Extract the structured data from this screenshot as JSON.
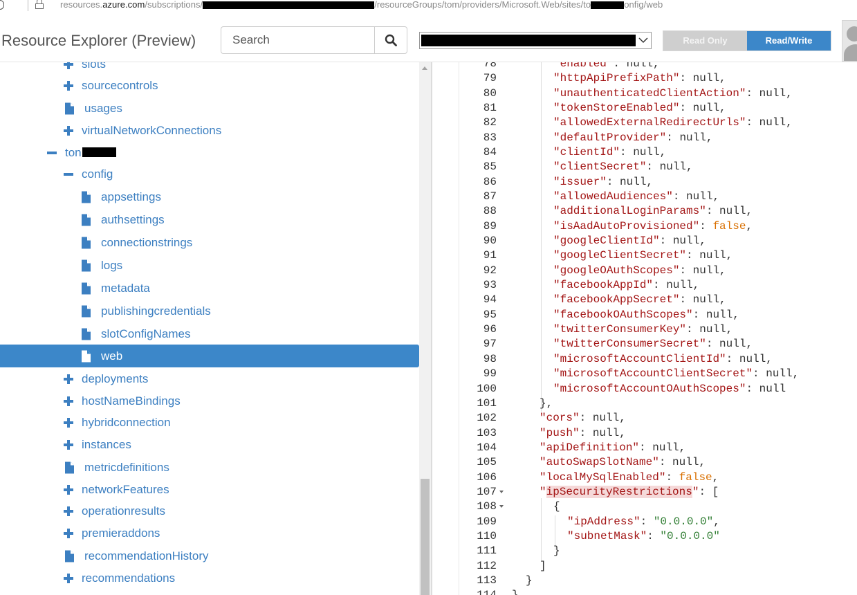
{
  "browser": {
    "url_prefix": "resources.",
    "url_domain": "azure.com",
    "url_part1": "/subscriptions/",
    "url_part2": "/resourceGroups/tom/providers/Microsoft.Web/sites/to",
    "url_part3": "onfig/web"
  },
  "header": {
    "title": "Resource Explorer (Preview)",
    "search_placeholder": "Search",
    "read_only_label": "Read Only",
    "read_write_label": "Read/Write",
    "accent_color": "#3c87c9"
  },
  "tree": {
    "items": [
      {
        "label": "slots",
        "icon": "plus-icon"
      },
      {
        "label": "sourcecontrols",
        "icon": "plus-icon"
      },
      {
        "label": "usages",
        "icon": "file-icon"
      },
      {
        "label": "virtualNetworkConnections",
        "icon": "plus-icon"
      },
      {
        "label": "ton",
        "icon": "minus-icon"
      },
      {
        "label": "config",
        "icon": "minus-icon"
      },
      {
        "label": "appsettings",
        "icon": "file-icon"
      },
      {
        "label": "authsettings",
        "icon": "file-icon"
      },
      {
        "label": "connectionstrings",
        "icon": "file-icon"
      },
      {
        "label": "logs",
        "icon": "file-icon"
      },
      {
        "label": "metadata",
        "icon": "file-icon"
      },
      {
        "label": "publishingcredentials",
        "icon": "file-icon"
      },
      {
        "label": "slotConfigNames",
        "icon": "file-icon"
      },
      {
        "label": "web",
        "icon": "file-icon",
        "selected": true
      },
      {
        "label": "deployments",
        "icon": "plus-icon"
      },
      {
        "label": "hostNameBindings",
        "icon": "plus-icon"
      },
      {
        "label": "hybridconnection",
        "icon": "plus-icon"
      },
      {
        "label": "instances",
        "icon": "plus-icon"
      },
      {
        "label": "metricdefinitions",
        "icon": "file-icon"
      },
      {
        "label": "networkFeatures",
        "icon": "plus-icon"
      },
      {
        "label": "operationresults",
        "icon": "plus-icon"
      },
      {
        "label": "premieraddons",
        "icon": "plus-icon"
      },
      {
        "label": "recommendationHistory",
        "icon": "file-icon"
      },
      {
        "label": "recommendations",
        "icon": "plus-icon"
      }
    ]
  },
  "editor": {
    "lines": [
      {
        "n": "78",
        "key": "enabled",
        "val": "null",
        "type": "null",
        "comma": true
      },
      {
        "n": "79",
        "key": "httpApiPrefixPath",
        "val": "null",
        "type": "null",
        "comma": true
      },
      {
        "n": "80",
        "key": "unauthenticatedClientAction",
        "val": "null",
        "type": "null",
        "comma": true
      },
      {
        "n": "81",
        "key": "tokenStoreEnabled",
        "val": "null",
        "type": "null",
        "comma": true
      },
      {
        "n": "82",
        "key": "allowedExternalRedirectUrls",
        "val": "null",
        "type": "null",
        "comma": true
      },
      {
        "n": "83",
        "key": "defaultProvider",
        "val": "null",
        "type": "null",
        "comma": true
      },
      {
        "n": "84",
        "key": "clientId",
        "val": "null",
        "type": "null",
        "comma": true
      },
      {
        "n": "85",
        "key": "clientSecret",
        "val": "null",
        "type": "null",
        "comma": true
      },
      {
        "n": "86",
        "key": "issuer",
        "val": "null",
        "type": "null",
        "comma": true
      },
      {
        "n": "87",
        "key": "allowedAudiences",
        "val": "null",
        "type": "null",
        "comma": true
      },
      {
        "n": "88",
        "key": "additionalLoginParams",
        "val": "null",
        "type": "null",
        "comma": true
      },
      {
        "n": "89",
        "key": "isAadAutoProvisioned",
        "val": "false",
        "type": "bool",
        "comma": true
      },
      {
        "n": "90",
        "key": "googleClientId",
        "val": "null",
        "type": "null",
        "comma": true
      },
      {
        "n": "91",
        "key": "googleClientSecret",
        "val": "null",
        "type": "null",
        "comma": true
      },
      {
        "n": "92",
        "key": "googleOAuthScopes",
        "val": "null",
        "type": "null",
        "comma": true
      },
      {
        "n": "93",
        "key": "facebookAppId",
        "val": "null",
        "type": "null",
        "comma": true
      },
      {
        "n": "94",
        "key": "facebookAppSecret",
        "val": "null",
        "type": "null",
        "comma": true
      },
      {
        "n": "95",
        "key": "facebookOAuthScopes",
        "val": "null",
        "type": "null",
        "comma": true
      },
      {
        "n": "96",
        "key": "twitterConsumerKey",
        "val": "null",
        "type": "null",
        "comma": true
      },
      {
        "n": "97",
        "key": "twitterConsumerSecret",
        "val": "null",
        "type": "null",
        "comma": true
      },
      {
        "n": "98",
        "key": "microsoftAccountClientId",
        "val": "null",
        "type": "null",
        "comma": true
      },
      {
        "n": "99",
        "key": "microsoftAccountClientSecret",
        "val": "null",
        "type": "null",
        "comma": true
      },
      {
        "n": "100",
        "key": "microsoftAccountOAuthScopes",
        "val": "null",
        "type": "null",
        "comma": false
      },
      {
        "n": "101",
        "raw": "},"
      },
      {
        "n": "102",
        "key": "cors",
        "val": "null",
        "type": "null",
        "comma": true
      },
      {
        "n": "103",
        "key": "push",
        "val": "null",
        "type": "null",
        "comma": true
      },
      {
        "n": "104",
        "key": "apiDefinition",
        "val": "null",
        "type": "null",
        "comma": true
      },
      {
        "n": "105",
        "key": "autoSwapSlotName",
        "val": "null",
        "type": "null",
        "comma": true
      },
      {
        "n": "106",
        "key": "localMySqlEnabled",
        "val": "false",
        "type": "bool",
        "comma": true
      },
      {
        "n": "107",
        "key": "ipSecurityRestrictions",
        "val": "[",
        "type": "punct",
        "comma": false,
        "fold": true,
        "highlight": true
      },
      {
        "n": "108",
        "raw": "{",
        "fold": true
      },
      {
        "n": "109",
        "key": "ipAddress",
        "val": "\"0.0.0.0\"",
        "type": "string",
        "comma": true
      },
      {
        "n": "110",
        "key": "subnetMask",
        "val": "\"0.0.0.0\"",
        "type": "string",
        "comma": false
      },
      {
        "n": "111",
        "raw": "}"
      },
      {
        "n": "112",
        "raw": "]"
      },
      {
        "n": "113",
        "raw": "}"
      },
      {
        "n": "114",
        "raw": "}"
      }
    ]
  }
}
